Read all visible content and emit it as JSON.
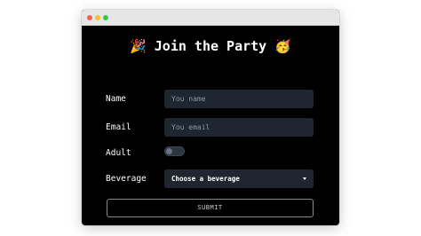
{
  "window": {
    "controls": [
      "close",
      "minimize",
      "maximize"
    ]
  },
  "form": {
    "title": "Join the Party",
    "title_emoji_left": "🎉",
    "title_emoji_right": "🥳",
    "name": {
      "label": "Name",
      "placeholder": "You name",
      "value": ""
    },
    "email": {
      "label": "Email",
      "placeholder": "You email",
      "value": ""
    },
    "adult": {
      "label": "Adult",
      "checked": false
    },
    "beverage": {
      "label": "Beverage",
      "selected": "Choose a beverage"
    },
    "submit_label": "SUBMIT"
  },
  "colors": {
    "background": "#000000",
    "input_bg": "#1f2630",
    "placeholder": "#8c96a4",
    "text": "#ffffff",
    "button_border": "#8a8a8a"
  }
}
